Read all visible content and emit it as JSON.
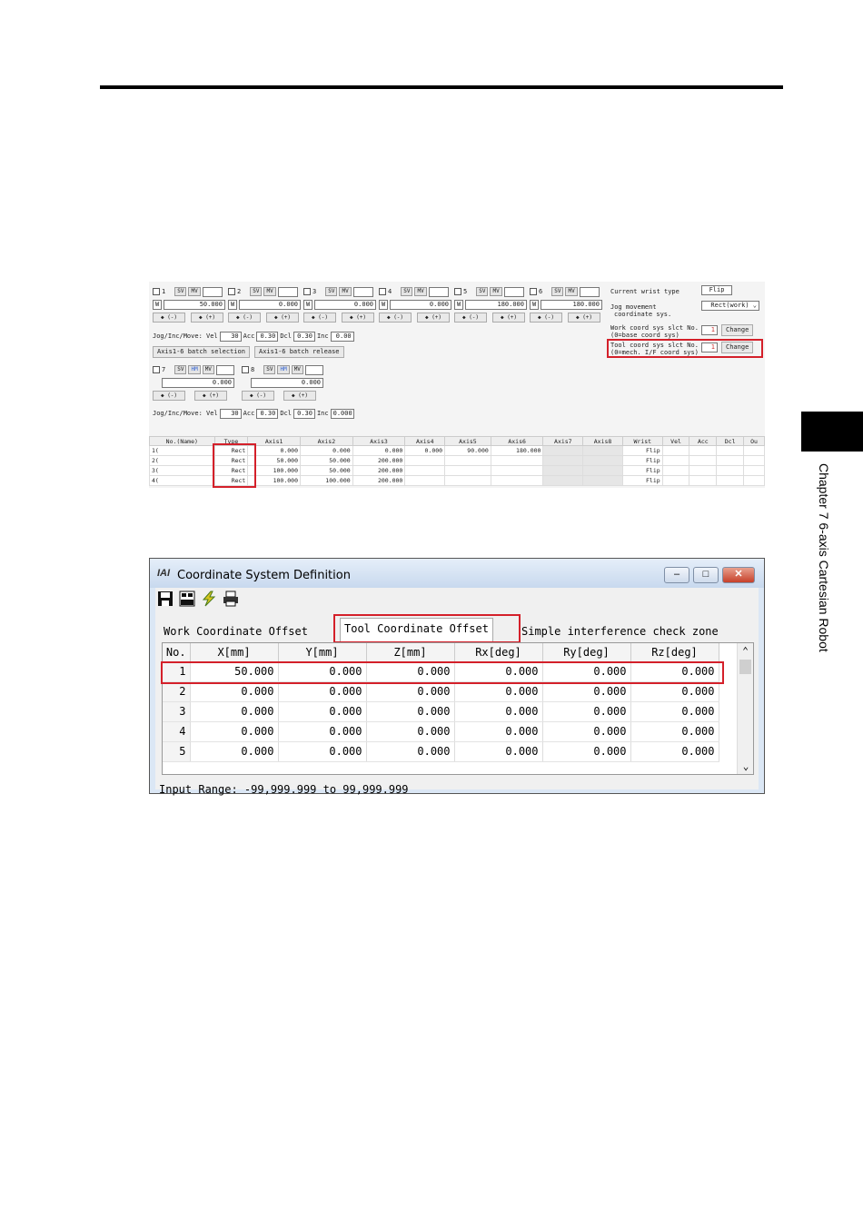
{
  "chapter_label": "Chapter 7 6-axis Cartesian Robot",
  "jog_panel": {
    "axes": [
      {
        "num": "1",
        "sv": "SV",
        "mv": "MV",
        "value": "50.000",
        "minus": "(-)",
        "plus": "(+)"
      },
      {
        "num": "2",
        "sv": "SV",
        "mv": "MV",
        "value": "0.000",
        "minus": "(-)",
        "plus": "(+)"
      },
      {
        "num": "3",
        "sv": "SV",
        "mv": "MV",
        "value": "0.000",
        "minus": "(-)",
        "plus": "(+)"
      },
      {
        "num": "4",
        "sv": "SV",
        "mv": "MV",
        "value": "0.000",
        "minus": "(-)",
        "plus": "(+)"
      },
      {
        "num": "5",
        "sv": "SV",
        "mv": "MV",
        "value": "180.000",
        "minus": "(-)",
        "plus": "(+)"
      },
      {
        "num": "6",
        "sv": "SV",
        "mv": "MV",
        "value": "180.000",
        "minus": "(-)",
        "plus": "(+)"
      }
    ],
    "axes_b": [
      {
        "num": "7",
        "sv": "SV",
        "hm": "HM",
        "mv": "MV",
        "value": "0.000",
        "minus": "(-)",
        "plus": "(+)"
      },
      {
        "num": "8",
        "sv": "SV",
        "hm": "HM",
        "mv": "MV",
        "value": "0.000",
        "minus": "(-)",
        "plus": "(+)"
      }
    ],
    "w_prefix": "W",
    "jog_label": "Jog/Inc/Move: Vel",
    "vel": "30",
    "acc_label": "Acc",
    "acc": "0.30",
    "dcl_label": "Dcl",
    "dcl": "0.30",
    "inc_label": "Inc",
    "inc": "0.00",
    "inc2": "0.000",
    "batch_select": "Axis1-6 batch selection",
    "batch_release": "Axis1-6 batch release",
    "wrist_type_label": "Current wrist type",
    "wrist_type": "Flip",
    "jog_move_label1": "Jog movement",
    "jog_move_label2": "coordinate sys.",
    "jog_move_value": "Rect(work)",
    "work_sel_label1": "Work coord sys slct No.",
    "work_sel_label2": "(0=base coord sys)",
    "work_sel_value": "1",
    "tool_sel_label1": "Tool coord sys slct No.",
    "tool_sel_label2": "(0=mech. I/F coord sys)",
    "tool_sel_value": "1",
    "change": "Change",
    "table_headers": [
      "No.(Name)",
      "Type",
      "Axis1",
      "Axis2",
      "Axis3",
      "Axis4",
      "Axis5",
      "Axis6",
      "Axis7",
      "Axis8",
      "Wrist",
      "Vel",
      "Acc",
      "Dcl",
      "Ou"
    ],
    "table_rows": [
      [
        "1(",
        "Rect",
        "0.000",
        "0.000",
        "0.000",
        "0.000",
        "90.000",
        "180.000",
        "",
        "",
        "Flip",
        "",
        "",
        "",
        ""
      ],
      [
        "2(",
        "Rect",
        "50.000",
        "50.000",
        "200.000",
        "",
        "",
        "",
        "",
        "",
        "Flip",
        "",
        "",
        "",
        ""
      ],
      [
        "3(",
        "Rect",
        "100.000",
        "50.000",
        "200.000",
        "",
        "",
        "",
        "",
        "",
        "Flip",
        "",
        "",
        "",
        ""
      ],
      [
        "4(",
        "Rect",
        "100.000",
        "100.000",
        "200.000",
        "",
        "",
        "",
        "",
        "",
        "Flip",
        "",
        "",
        "",
        ""
      ]
    ]
  },
  "dialog": {
    "title": "Coordinate System Definition",
    "logo": "IAI",
    "tabs": [
      "Work Coordinate Offset",
      "Tool Coordinate Offset",
      "Simple interference check zone"
    ],
    "headers": [
      "No.",
      "X[mm]",
      "Y[mm]",
      "Z[mm]",
      "Rx[deg]",
      "Ry[deg]",
      "Rz[deg]"
    ],
    "rows": [
      [
        "1",
        "50.000",
        "0.000",
        "0.000",
        "0.000",
        "0.000",
        "0.000"
      ],
      [
        "2",
        "0.000",
        "0.000",
        "0.000",
        "0.000",
        "0.000",
        "0.000"
      ],
      [
        "3",
        "0.000",
        "0.000",
        "0.000",
        "0.000",
        "0.000",
        "0.000"
      ],
      [
        "4",
        "0.000",
        "0.000",
        "0.000",
        "0.000",
        "0.000",
        "0.000"
      ],
      [
        "5",
        "0.000",
        "0.000",
        "0.000",
        "0.000",
        "0.000",
        "0.000"
      ]
    ],
    "status": "Input Range: -99,999.999 to 99,999.999",
    "icons": [
      "save-icon",
      "sel-icon",
      "lightning-icon",
      "printer-icon"
    ]
  },
  "colors": {
    "highlight": "#d4202a",
    "arrow": "#2a8a2a"
  }
}
